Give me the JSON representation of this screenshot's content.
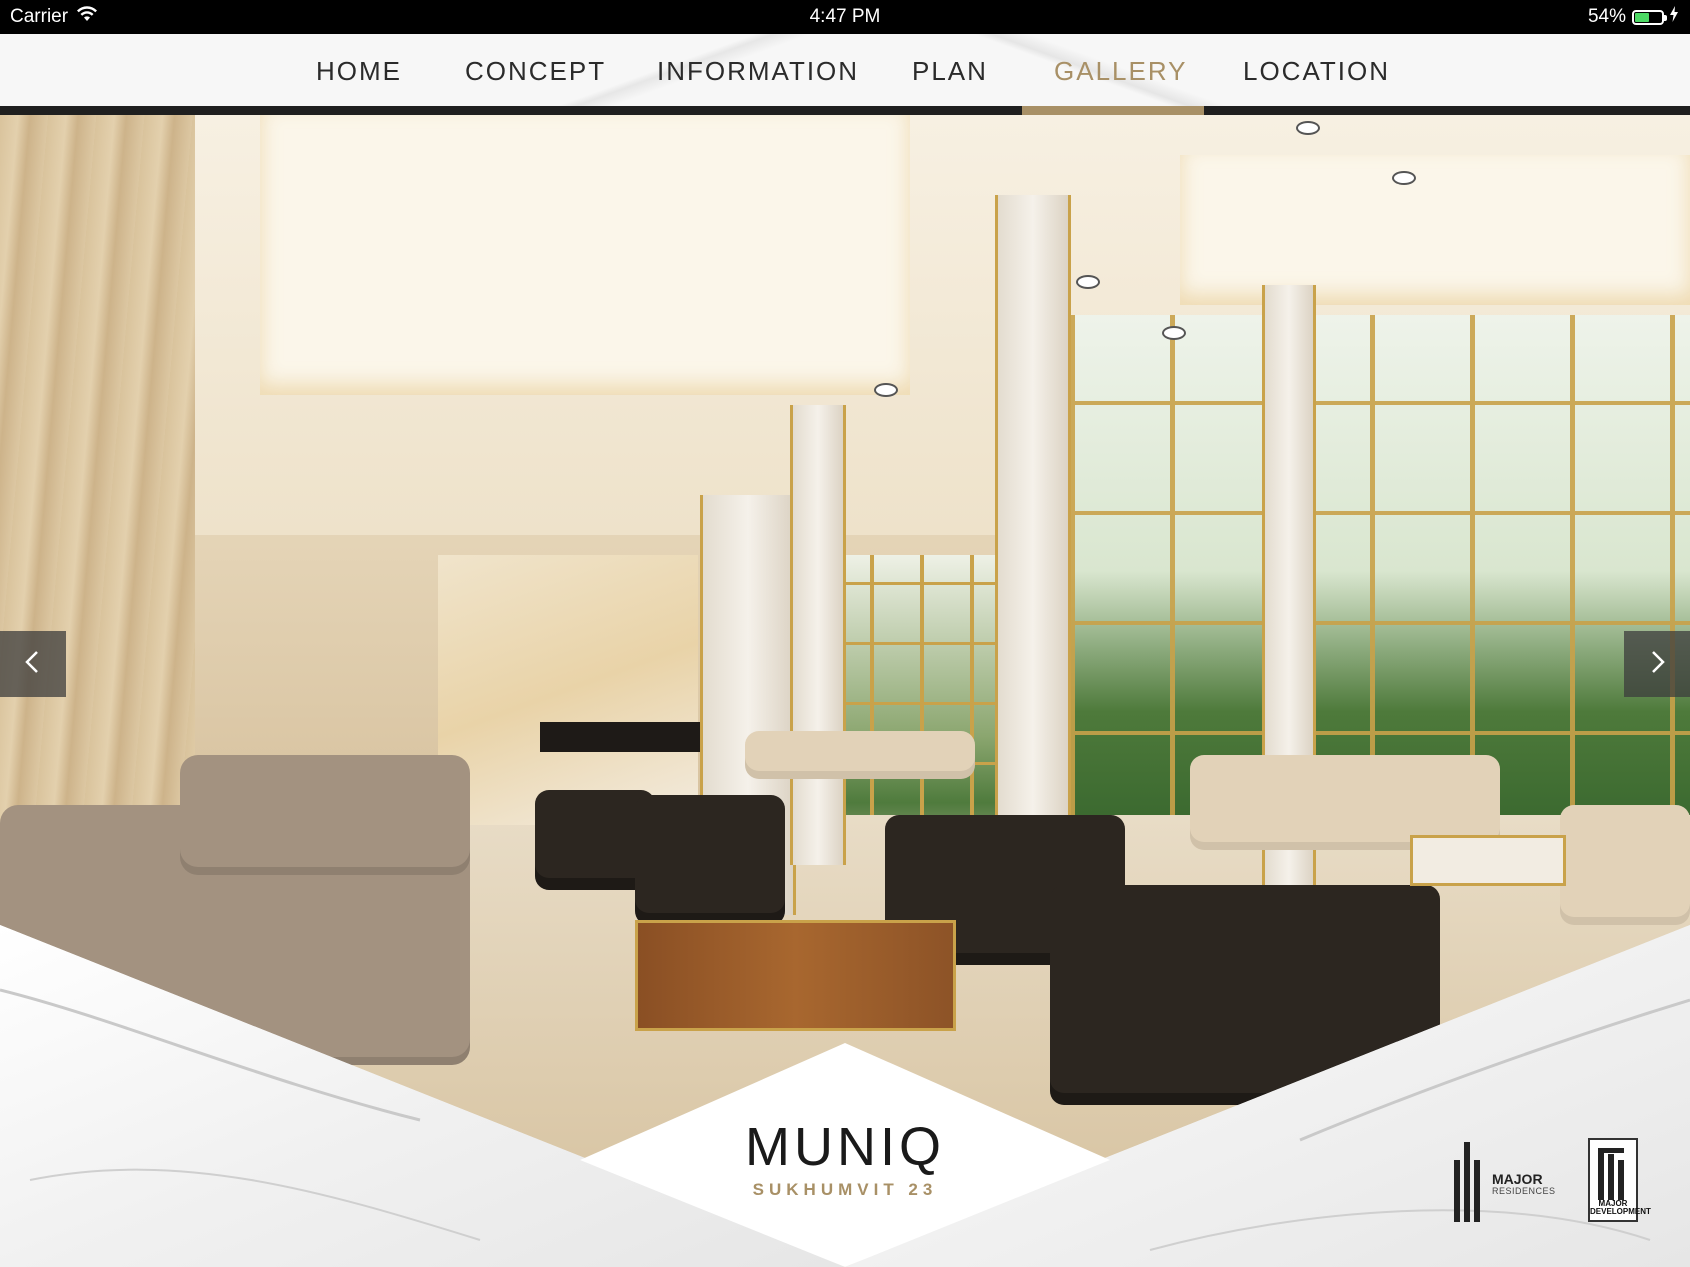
{
  "status_bar": {
    "carrier": "Carrier",
    "time": "4:47 PM",
    "battery_percent": "54%",
    "battery_level": 0.54,
    "wifi_icon": "wifi-icon",
    "battery_icon": "battery-icon",
    "charging_icon": "charging-bolt-icon"
  },
  "nav": {
    "items": [
      {
        "label": "HOME"
      },
      {
        "label": "CONCEPT"
      },
      {
        "label": "INFORMATION"
      },
      {
        "label": "PLAN"
      },
      {
        "label": "GALLERY",
        "active": true
      },
      {
        "label": "LOCATION"
      }
    ],
    "active_color": "#a89066",
    "text_color": "#2b2b2b"
  },
  "gallery": {
    "prev_icon": "chevron-left-icon",
    "next_icon": "chevron-right-icon",
    "image": "lobby-interior-photo"
  },
  "branding": {
    "project_name": "MUNIQ",
    "project_sub": "SUKHUMVIT 23",
    "major_residences_line1": "MAJOR",
    "major_residences_line2": "RESIDENCES",
    "major_development": "MAJOR DEVELOPMENT",
    "accent_color": "#a89066"
  }
}
